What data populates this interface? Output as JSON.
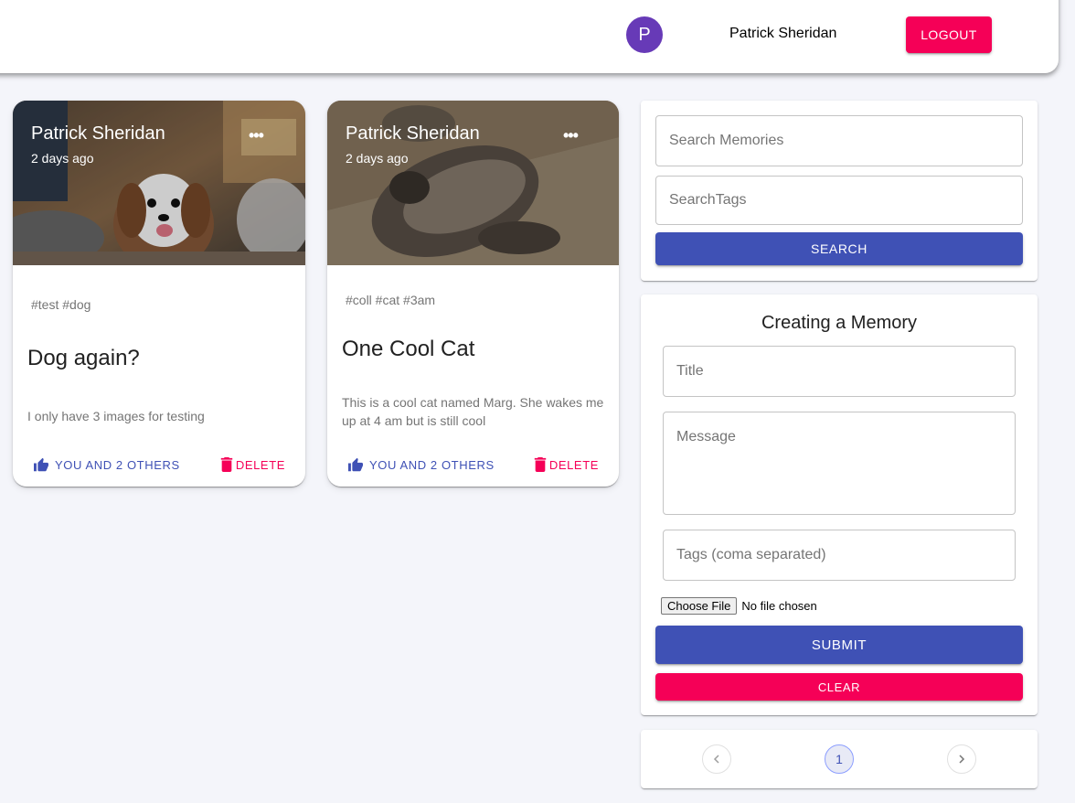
{
  "header": {
    "avatar_initial": "P",
    "user_name": "Patrick Sheridan",
    "logout_label": "LOGOUT"
  },
  "posts": [
    {
      "author": "Patrick Sheridan",
      "time": "2 days ago",
      "tags": "#test #dog",
      "title": "Dog again?",
      "message": "I only have 3 images for testing",
      "like_label": "YOU AND 2 OTHERS",
      "delete_label": "DELETE",
      "image": "dog-photo"
    },
    {
      "author": "Patrick Sheridan",
      "time": "2 days ago",
      "tags": "#coll #cat #3am",
      "title": "One Cool Cat",
      "message": "This is a cool cat named Marg. She wakes me up at 4 am but is still cool",
      "like_label": "YOU AND 2 OTHERS",
      "delete_label": "DELETE",
      "image": "cat-photo"
    }
  ],
  "search": {
    "memories_placeholder": "Search Memories",
    "tags_placeholder": "SearchTags",
    "button_label": "SEARCH"
  },
  "form": {
    "title": "Creating a Memory",
    "title_placeholder": "Title",
    "message_placeholder": "Message",
    "tags_placeholder": "Tags (coma separated)",
    "file_button": "Choose File",
    "file_status": "No file chosen",
    "submit_label": "SUBMIT",
    "clear_label": "CLEAR"
  },
  "pagination": {
    "current_page": "1",
    "prev_icon": "chevron-left-icon",
    "next_icon": "chevron-right-icon"
  },
  "colors": {
    "primary": "#3f51b5",
    "secondary": "#f50057",
    "avatar": "#673ab7",
    "background": "#f4f5fa"
  }
}
